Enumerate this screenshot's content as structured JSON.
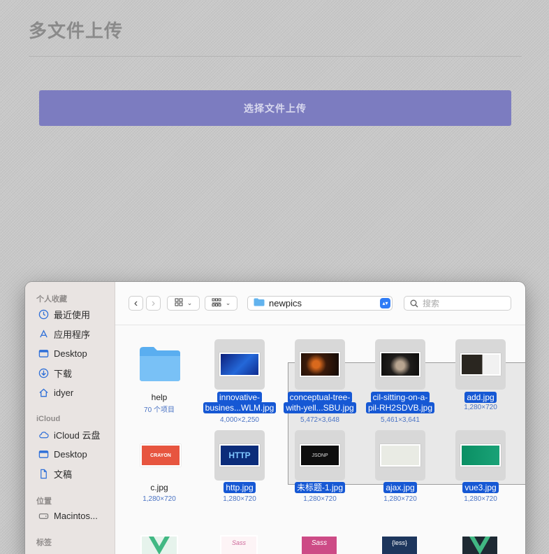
{
  "page": {
    "title": "多文件上传",
    "upload_button": "选择文件上传"
  },
  "sidebar": {
    "favorites_header": "个人收藏",
    "favorites": [
      {
        "label": "最近使用",
        "icon": "clock-icon"
      },
      {
        "label": "应用程序",
        "icon": "apps-icon"
      },
      {
        "label": "Desktop",
        "icon": "desktop-icon"
      },
      {
        "label": "下载",
        "icon": "download-icon"
      },
      {
        "label": "idyer",
        "icon": "home-icon"
      }
    ],
    "icloud_header": "iCloud",
    "icloud": [
      {
        "label": "iCloud 云盘",
        "icon": "cloud-icon"
      },
      {
        "label": "Desktop",
        "icon": "desktop-icon"
      },
      {
        "label": "文稿",
        "icon": "document-icon"
      }
    ],
    "locations_header": "位置",
    "locations": [
      {
        "label": "Macintos...",
        "icon": "disk-icon"
      }
    ],
    "tags_header": "标签"
  },
  "toolbar": {
    "back": "‹",
    "forward": "›",
    "view_icon": "grid-view-icon",
    "group_icon": "group-view-icon",
    "path": "newpics",
    "search_placeholder": "搜索"
  },
  "files": [
    {
      "name": "help",
      "meta": "70 个项目",
      "kind": "folder",
      "selected": false
    },
    {
      "name": "innovative-busines...WLM.jpg",
      "name_lines": [
        "innovative-",
        "busines...WLM.jpg"
      ],
      "meta": "4,000×2,250",
      "selected": true
    },
    {
      "name": "conceptual-tree-with-yell...SBU.jpg",
      "name_lines": [
        "conceptual-tree-",
        "with-yell...SBU.jpg"
      ],
      "meta": "5,472×3,648",
      "selected": true
    },
    {
      "name": "cil-sitting-on-a-pil-RH2SDVB.jpg",
      "name_lines": [
        "cil-sitting-on-a-",
        "pil-RH2SDVB.jpg"
      ],
      "meta": "5,461×3,641",
      "selected": true
    },
    {
      "name": "add.jpg",
      "meta": "1,280×720",
      "selected": true
    },
    {
      "name": "c.jpg",
      "meta": "1,280×720",
      "selected": false
    },
    {
      "name": "http.jpg",
      "meta": "1,280×720",
      "selected": true
    },
    {
      "name": "未标题-1.jpg",
      "meta": "1,280×720",
      "selected": true
    },
    {
      "name": "ajax.jpg",
      "meta": "1,280×720",
      "selected": true
    },
    {
      "name": "vue3.jpg",
      "meta": "1,280×720",
      "selected": true
    }
  ],
  "thumb_text": {
    "crayon": "CRAYON",
    "http": "HTTP",
    "jsonp": "JSONP",
    "less": "{less}",
    "sass": "Sass"
  },
  "colors": {
    "selection": "#1658d4",
    "accent": "#2f7cf6",
    "button": "#7c7cc0"
  }
}
